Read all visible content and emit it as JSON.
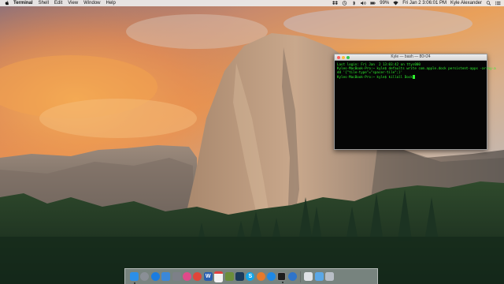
{
  "menubar": {
    "app_name": "Terminal",
    "menus": [
      "Shell",
      "Edit",
      "View",
      "Window",
      "Help"
    ],
    "battery": "99%",
    "datetime": "Fri Jan 2  3:06:01 PM",
    "user": "Kyle Alexander"
  },
  "terminal": {
    "title": "Kyle — bash — 80×24",
    "lines": [
      "Last login: Fri Jan  2 13:03:42 on ttys000",
      "Kyles-MacBook-Pro:~ kyle$ defaults write com.apple.dock persistent-apps -array-a",
      "dd '{\"tile-type\"=\"spacer-tile\";}'",
      "Kyles-MacBook-Pro:~ kyle$ killall Dock"
    ]
  },
  "dock": {
    "icons": [
      {
        "name": "finder",
        "color": "#2c8fe8",
        "glyph": ""
      },
      {
        "name": "launchpad",
        "color": "#8a8f96",
        "glyph": ""
      },
      {
        "name": "safari",
        "color": "#1a7ce0",
        "glyph": ""
      },
      {
        "name": "mail",
        "color": "#3b88d9",
        "glyph": ""
      },
      {
        "name": "system-preferences",
        "color": "#7d8088",
        "glyph": ""
      },
      {
        "name": "itunes",
        "color": "#e04a8a",
        "glyph": ""
      },
      {
        "name": "chrome",
        "color": "#e0453a",
        "glyph": ""
      },
      {
        "name": "word",
        "color": "#2a5fb0",
        "glyph": "W"
      },
      {
        "name": "calendar",
        "color": "#f2f2f2",
        "glyph": ""
      },
      {
        "name": "minecraft",
        "color": "#6b8e3a",
        "glyph": ""
      },
      {
        "name": "steam",
        "color": "#1b3a5a",
        "glyph": ""
      },
      {
        "name": "skype",
        "color": "#12a5e8",
        "glyph": "S"
      },
      {
        "name": "firefox",
        "color": "#e6792a",
        "glyph": ""
      },
      {
        "name": "app-store",
        "color": "#1e88e5",
        "glyph": ""
      },
      {
        "name": "terminal",
        "color": "#1c1c1c",
        "glyph": ""
      },
      {
        "name": "quicktime",
        "color": "#2f74c9",
        "glyph": ""
      },
      {
        "name": "documents-stack",
        "color": "#dfe2e6",
        "glyph": ""
      },
      {
        "name": "folder-stack",
        "color": "#5aa7e6",
        "glyph": ""
      },
      {
        "name": "trash",
        "color": "#b8bec6",
        "glyph": ""
      }
    ]
  }
}
